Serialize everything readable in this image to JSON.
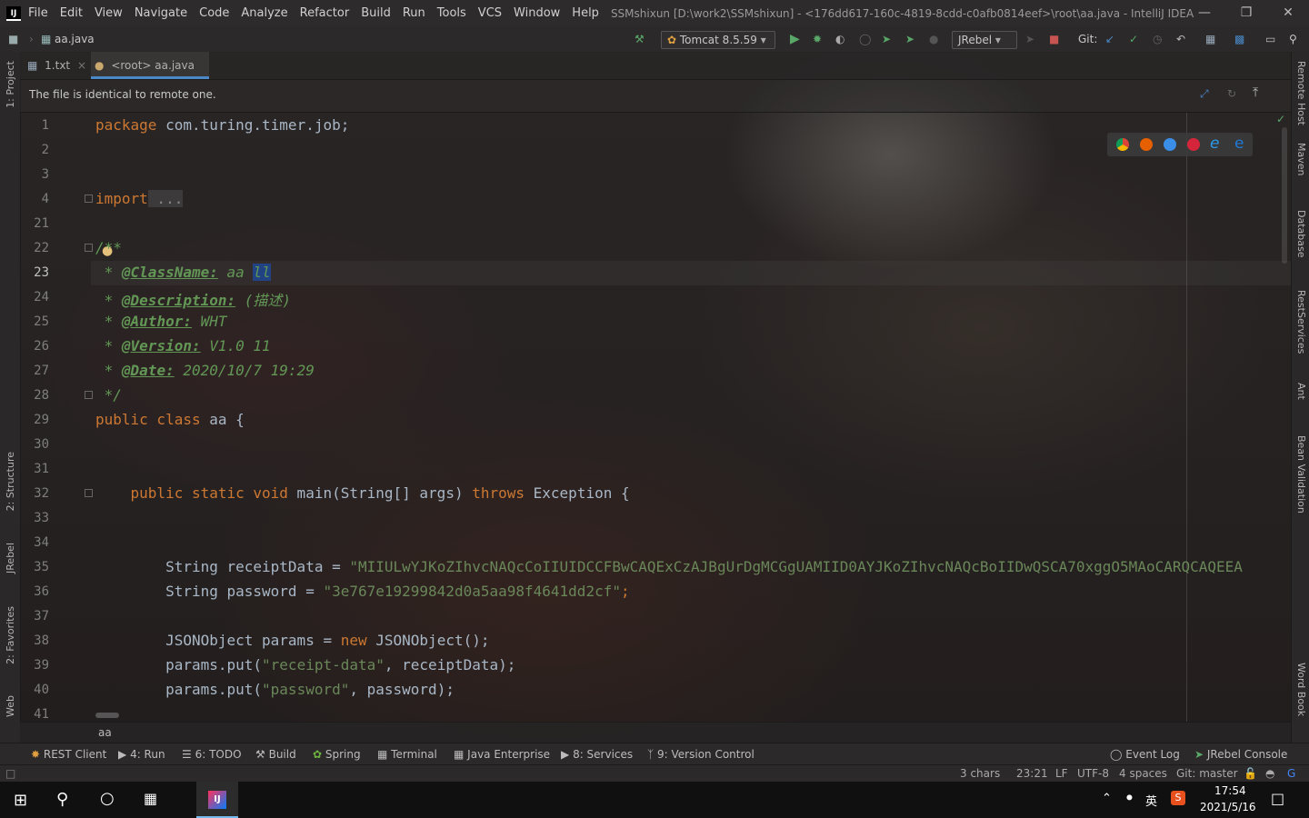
{
  "menu": {
    "items": [
      "File",
      "Edit",
      "View",
      "Navigate",
      "Code",
      "Analyze",
      "Refactor",
      "Build",
      "Run",
      "Tools",
      "VCS",
      "Window",
      "Help"
    ],
    "title": "SSMshixun [D:\\work2\\SSMshixun] - <176dd617-160c-4819-8cdd-c0afb0814eef>\\root\\aa.java - IntelliJ IDEA"
  },
  "navbar": {
    "breadcrumb": "aa.java",
    "run_config": "Tomcat 8.5.59",
    "jrebel": "JRebel",
    "git_label": "Git:"
  },
  "tabs": [
    {
      "label": "1.txt"
    },
    {
      "label": "<root> aa.java"
    }
  ],
  "banner": {
    "text": "The file is identical to remote one."
  },
  "editor": {
    "line_numbers": [
      "1",
      "2",
      "3",
      "4",
      "21",
      "22",
      "23",
      "24",
      "25",
      "26",
      "27",
      "28",
      "29",
      "30",
      "31",
      "32",
      "33",
      "34",
      "35",
      "36",
      "37",
      "38",
      "39",
      "40",
      "41"
    ],
    "lines": {
      "l1_kw": "package",
      "l1_rest": " com.turing.timer.job;",
      "l4_kw": "import",
      "l4_rest": " ...",
      "l22": "/**",
      "l23_tag": "@ClassName:",
      "l23_val": " aa",
      "l23_sel": "ll",
      "l24_tag": "@Description:",
      "l24_val": " (描述)",
      "l25_tag": "@Author:",
      "l25_val": " WHT",
      "l26_tag": "@Version:",
      "l26_val": " V1.0 11",
      "l27_tag": "@Date:",
      "l27_val": " 2020/10/7 19:29",
      "l28": " */",
      "l29_kw": "public class",
      "l29_rest": " aa {",
      "l32_kw": "public static void",
      "l32_mid": " main(String[] args) ",
      "l32_kw2": "throws",
      "l32_rest": " Exception {",
      "l35_pre": "String receiptData = ",
      "l35_str": "\"MIIULwYJKoZIhvcNAQcCoIIUIDCCFBwCAQExCzAJBgUrDgMCGgUAMIID0AYJKoZIhvcNAQcBoIIDwQSCA70xggO5MAoCARQCAQEEA",
      "l36_pre": "String password = ",
      "l36_str": "\"3e767e19299842d0a5aa98f4641dd2cf\"",
      "l36_end": ";",
      "l38_pre": "JSONObject params = ",
      "l38_kw": "new",
      "l38_rest": " JSONObject();",
      "l39_pre": "params.put(",
      "l39_str": "\"receipt-data\"",
      "l39_rest": ", receiptData);",
      "l40_pre": "params.put(",
      "l40_str": "\"password\"",
      "l40_rest": ", password);"
    },
    "breadcrumb": "aa"
  },
  "left_panels": [
    "1: Project",
    "2: Structure",
    "JRebel",
    "2: Favorites",
    "Web"
  ],
  "right_panels": [
    "Remote Host",
    "Maven",
    "Database",
    "RestServices",
    "Ant",
    "Bean Validation",
    "Word Book"
  ],
  "toolwindows": [
    "REST Client",
    "4: Run",
    "6: TODO",
    "Build",
    "Spring",
    "Terminal",
    "Java Enterprise",
    "8: Services",
    "9: Version Control",
    "Event Log",
    "JRebel Console"
  ],
  "status": {
    "chars": "3 chars",
    "position": "23:21",
    "line_sep": "LF",
    "encoding": "UTF-8",
    "indent": "4 spaces",
    "git": "Git: master"
  },
  "taskbar": {
    "ime": "英",
    "time": "17:54",
    "date": "2021/5/16"
  },
  "colors": {
    "keyword": "#cc7832",
    "string": "#6a8759",
    "doc": "#629755",
    "accent": "#4a88c7"
  }
}
